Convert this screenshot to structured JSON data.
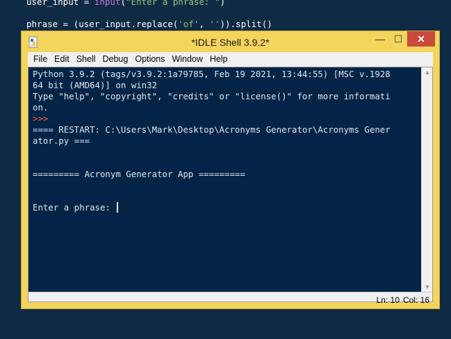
{
  "background_editor": {
    "line1": {
      "var": "user_input = ",
      "builtin": "input",
      "paren_open": "(",
      "string": "\"Enter a phrase: \"",
      "paren_close": ")"
    },
    "line2": {
      "pre": "phrase = (user_input.replace(",
      "s1": "'of'",
      "comma": ", ",
      "s2": "''",
      "post": ")).split()"
    }
  },
  "window": {
    "title": "*IDLE Shell 3.9.2*",
    "icon": "python-idle-icon",
    "buttons": {
      "minimize": "—",
      "maximize": "☐",
      "close": "✕"
    }
  },
  "menu": {
    "items": [
      "File",
      "Edit",
      "Shell",
      "Debug",
      "Options",
      "Window",
      "Help"
    ]
  },
  "shell": {
    "lines": [
      "Python 3.9.2 (tags/v3.9.2:1a79785, Feb 19 2021, 13:44:55) [MSC v.1928",
      "64 bit (AMD64)] on win32",
      "Type \"help\", \"copyright\", \"credits\" or \"license()\" for more informati",
      "on.",
      ">>>",
      "==== RESTART: C:\\Users\\Mark\\Desktop\\Acronyms Generator\\Acronyms Gener",
      "ator.py ===",
      "",
      "",
      "========= Acronym Generator App =========",
      "",
      "",
      "Enter a phrase: "
    ]
  },
  "status": {
    "line": "Ln: 10",
    "col": "Col: 16"
  },
  "colors": {
    "shell_bg": "#032447",
    "prompt": "#ff5a3a",
    "title_bar": "#f3d45c",
    "close_button": "#c94a3c"
  }
}
